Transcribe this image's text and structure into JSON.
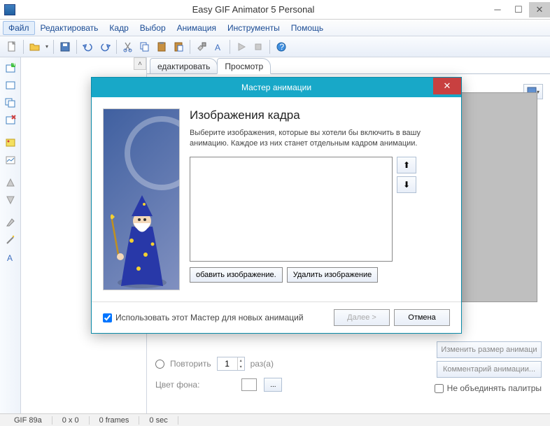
{
  "app": {
    "title": "Easy GIF Animator 5 Personal"
  },
  "menu": [
    "Файл",
    "Редактировать",
    "Кадр",
    "Выбор",
    "Анимация",
    "Инструменты",
    "Помощь"
  ],
  "tabs": {
    "edit": "едактировать",
    "preview": "Просмотр"
  },
  "lower": {
    "repeat_label": "Повторить",
    "repeat_value": "1",
    "times_label": "раз(а)",
    "bg_label": "Цвет фона:"
  },
  "right_buttons": {
    "resize": "Изменить размер анимаци",
    "comment": "Комментарий анимации..."
  },
  "merge_palettes": "Не объединять палитры",
  "status": {
    "format": "GIF 89a",
    "size": "0 x 0",
    "frames": "0 frames",
    "time": "0 sec"
  },
  "dialog": {
    "title": "Мастер анимации",
    "heading": "Изображения кадра",
    "desc": "Выберите изображения, которые вы хотели бы включить в вашу анимацию. Каждое из них станет отдельным кадром анимации.",
    "add_btn": "обавить изображение.",
    "del_btn": "Удалить изображение",
    "use_wizard": "Использовать этот Мастер для новых анимаций",
    "next": "Далее >",
    "cancel": "Отмена"
  }
}
